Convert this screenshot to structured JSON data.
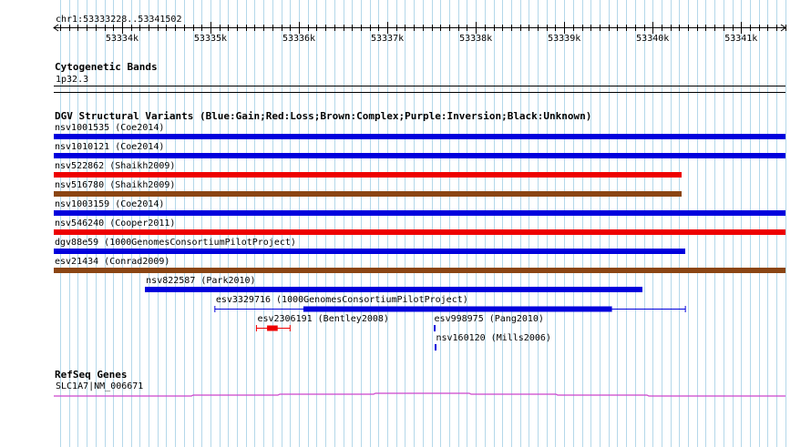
{
  "region": "chr1:53333228..53341502",
  "ruler": {
    "start": 53333228,
    "end": 53341502,
    "ticks": [
      {
        "pos": 53334000,
        "label": "53334k"
      },
      {
        "pos": 53335000,
        "label": "53335k"
      },
      {
        "pos": 53336000,
        "label": "53336k"
      },
      {
        "pos": 53337000,
        "label": "53337k"
      },
      {
        "pos": 53338000,
        "label": "53338k"
      },
      {
        "pos": 53339000,
        "label": "53339k"
      },
      {
        "pos": 53340000,
        "label": "53340k"
      },
      {
        "pos": 53341000,
        "label": "53341k"
      }
    ]
  },
  "cytoband": {
    "title": "Cytogenetic Bands",
    "band": "1p32.3"
  },
  "dgv": {
    "title": "DGV Structural Variants (Blue:Gain;Red:Loss;Brown:Complex;Purple:Inversion;Black:Unknown)",
    "colors": {
      "gain": "#0000dd",
      "loss": "#ee0000",
      "complex": "#8b4513"
    },
    "variants": [
      {
        "label": "nsv1001535 (Coe2014)",
        "type": "gain",
        "start": 53333228,
        "end": 53341502
      },
      {
        "label": "nsv1010121 (Coe2014)",
        "type": "gain",
        "start": 53333228,
        "end": 53341502
      },
      {
        "label": "nsv522862 (Shaikh2009)",
        "type": "loss",
        "start": 53333228,
        "end": 53340330
      },
      {
        "label": "nsv516780 (Shaikh2009)",
        "type": "complex",
        "start": 53333228,
        "end": 53340330
      },
      {
        "label": "nsv1003159 (Coe2014)",
        "type": "gain",
        "start": 53333228,
        "end": 53341502
      },
      {
        "label": "nsv546240 (Cooper2011)",
        "type": "loss",
        "start": 53333228,
        "end": 53341502
      },
      {
        "label": "dgv88e59 (1000GenomesConsortiumPilotProject)",
        "type": "gain",
        "start": 53333228,
        "end": 53340370
      },
      {
        "label": "esv21434 (Conrad2009)",
        "type": "complex",
        "start": 53333228,
        "end": 53341502
      },
      {
        "label": "nsv822587 (Park2010)",
        "type": "gain",
        "start": 53334260,
        "end": 53339880
      },
      {
        "label": "esv3329716 (1000GenomesConsortiumPilotProject)",
        "type": "gain",
        "start": 53335050,
        "end": 53340370,
        "thick_start": 53336050,
        "thick_end": 53339540
      },
      {
        "label": "esv2306191 (Bentley2008)",
        "type": "loss",
        "start": 53335520,
        "end": 53335900,
        "thick_start": 53335640,
        "thick_end": 53335760
      },
      {
        "label": "esv998975 (Pang2010)",
        "type": "gain",
        "start": 53337520,
        "end": 53337540
      },
      {
        "label": "nsv160120 (Mills2006)",
        "type": "gain",
        "start": 53337540,
        "end": 53337560
      }
    ]
  },
  "refseq": {
    "title": "RefSeq Genes",
    "gene": "SLC1A7|NM_006671",
    "color": "#cc44cc"
  }
}
